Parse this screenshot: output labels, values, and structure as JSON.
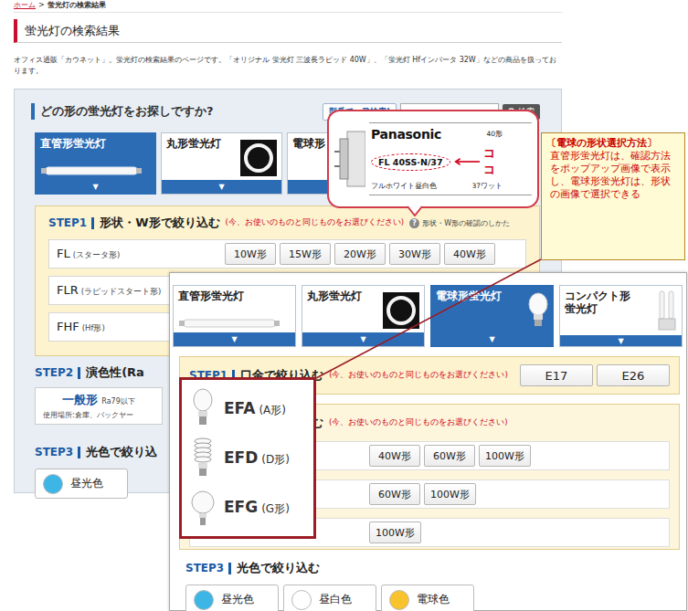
{
  "breadcrumb": {
    "home": "ホーム",
    "separator": ">",
    "current": "蛍光灯の検索結果"
  },
  "page_title": "蛍光灯の検索結果",
  "description": "オフィス通販「カウネット」。蛍光灯の検索結果のページです。「オリジナル 蛍光灯 三波長ラピッド 40W」、「蛍光灯 Hfインバータ 32W」などの商品を扱っております。",
  "finder": {
    "heading": "どの形の蛍光灯をお探しですか?",
    "model_search": {
      "label": "型番で一発検索!",
      "value": "",
      "button": "検索"
    },
    "tab_marker": "▼",
    "tabs": [
      {
        "label": "直管形蛍光灯",
        "selected": true,
        "kind": "tube"
      },
      {
        "label": "丸形蛍光灯",
        "selected": false,
        "kind": "ring"
      },
      {
        "label": "電球形",
        "selected": false,
        "kind": "bulb"
      }
    ],
    "step1": {
      "step": "STEP1",
      "title": "形状・W形で絞り込む",
      "note": "(今、お使いのものと同じものをお選びください)",
      "help_icon": "?",
      "help_link": "形状・W形の確認のしかた",
      "rows": [
        {
          "type": "FL",
          "desc": "(スタータ形)",
          "options": [
            "10W形",
            "15W形",
            "20W形",
            "30W形",
            "40W形"
          ]
        },
        {
          "type": "FLR",
          "desc": "(ラピッドスタート形)",
          "options": []
        },
        {
          "type": "FHF",
          "desc": "(Hf形)",
          "options": []
        }
      ]
    },
    "step2": {
      "step": "STEP2",
      "title": "演色性(Ra",
      "options": [
        {
          "label": "一般形",
          "sub": "Ra79以下",
          "usage": "使用場所:倉庫、バックヤー"
        }
      ]
    },
    "step3": {
      "step": "STEP3",
      "title": "光色で絞り込",
      "options": [
        {
          "label": "昼光色",
          "color": "#3db6e6"
        }
      ]
    }
  },
  "detail_view": {
    "tab_marker": "▼",
    "tabs": [
      {
        "label": "直管形蛍光灯",
        "selected": false,
        "kind": "tube"
      },
      {
        "label": "丸形蛍光灯",
        "selected": false,
        "kind": "ring"
      },
      {
        "label": "電球形蛍光灯",
        "selected": true,
        "kind": "bulb"
      },
      {
        "label": "コンパクト形蛍光灯",
        "selected": false,
        "kind": "compact"
      }
    ],
    "step1": {
      "step": "STEP1",
      "title": "口金で絞り込む",
      "note": "(今、お使いのものと同じものをお選びください)",
      "options": [
        "E17",
        "E26"
      ]
    },
    "step2": {
      "title_tail": "む",
      "note": "(今、お使いのものと同じものをお選びください)",
      "rows": [
        {
          "options": [
            "40W形",
            "60W形",
            "100W形"
          ]
        },
        {
          "options": [
            "60W形",
            "100W形"
          ]
        },
        {
          "options": [
            "100W形"
          ]
        }
      ]
    },
    "step3": {
      "step": "STEP3",
      "title": "光色で絞り込む",
      "options": [
        {
          "label": "昼光色",
          "color": "#3db6e6"
        },
        {
          "label": "昼白色",
          "color": "#ffffff"
        },
        {
          "label": "電球色",
          "color": "#f9c32e"
        }
      ]
    }
  },
  "shape_zoom": [
    {
      "code": "EFA",
      "shape": "(A形)",
      "kind": "a"
    },
    {
      "code": "EFD",
      "shape": "(D形)",
      "kind": "d"
    },
    {
      "code": "EFG",
      "shape": "(G形)",
      "kind": "g"
    }
  ],
  "popup": {
    "brand": "Panasonic",
    "size": "40形",
    "model": "FL 40SS·N/37",
    "color_name": "フルホワイト昼白色",
    "watt": "37ワット",
    "pointer_label": "ココ"
  },
  "annotation": {
    "title": "〔電球の形状選択方法〕",
    "body": "直管形蛍光灯は、確認方法をポップアップ画像で表示し、電球形蛍光灯は、形状の画像で選択できる"
  }
}
